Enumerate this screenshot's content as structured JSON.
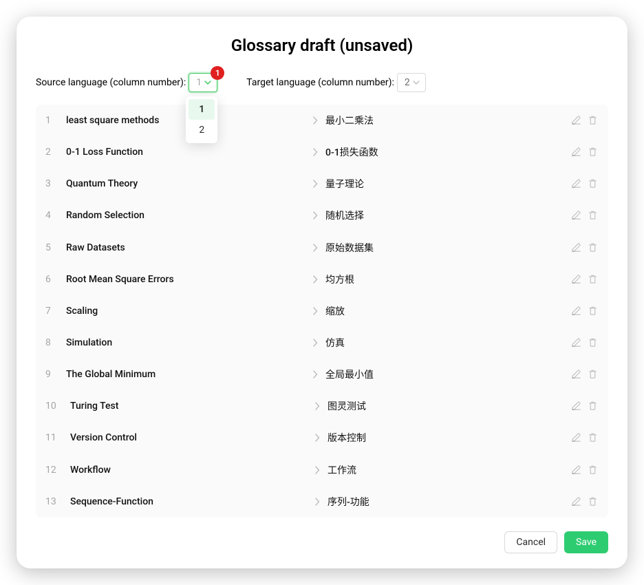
{
  "title": "Glossary draft (unsaved)",
  "source_selector": {
    "label": "Source language (column number):",
    "value": "1",
    "badge": "1",
    "options": [
      "1",
      "2"
    ]
  },
  "target_selector": {
    "label": "Target language (column number):",
    "value": "2"
  },
  "rows": [
    {
      "n": "1",
      "src": "least square methods",
      "tgt": "最小二乘法"
    },
    {
      "n": "2",
      "src": "0-1 Loss Function",
      "tgt": "0-1损失函数"
    },
    {
      "n": "3",
      "src": "Quantum Theory",
      "tgt": "量子理论"
    },
    {
      "n": "4",
      "src": "Random Selection",
      "tgt": "随机选择"
    },
    {
      "n": "5",
      "src": "Raw Datasets",
      "tgt": "原始数据集"
    },
    {
      "n": "6",
      "src": "Root Mean Square Errors",
      "tgt": "均方根"
    },
    {
      "n": "7",
      "src": "Scaling",
      "tgt": "缩放"
    },
    {
      "n": "8",
      "src": "Simulation",
      "tgt": "仿真"
    },
    {
      "n": "9",
      "src": "The Global Minimum",
      "tgt": "全局最小值"
    },
    {
      "n": "10",
      "src": "Turing Test",
      "tgt": "图灵测试"
    },
    {
      "n": "11",
      "src": "Version Control",
      "tgt": "版本控制"
    },
    {
      "n": "12",
      "src": "Workflow",
      "tgt": "工作流"
    },
    {
      "n": "13",
      "src": "Sequence-Function",
      "tgt": "序列-功能"
    }
  ],
  "buttons": {
    "cancel": "Cancel",
    "save": "Save"
  }
}
